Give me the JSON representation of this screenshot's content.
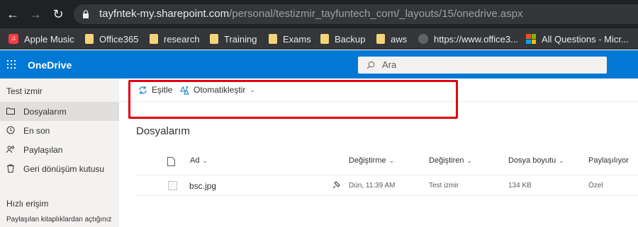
{
  "browser": {
    "url_host": "tayfntek-my.sharepoint.com",
    "url_path": "/personal/testizmir_tayfuntech_com/_layouts/15/onedrive.aspx",
    "bookmarks": [
      {
        "label": "Apple Music",
        "icon": "apple-music-icon"
      },
      {
        "label": "Office365",
        "icon": "folder-icon"
      },
      {
        "label": "research",
        "icon": "folder-icon"
      },
      {
        "label": "Training",
        "icon": "folder-icon"
      },
      {
        "label": "Exams",
        "icon": "folder-icon"
      },
      {
        "label": "Backup",
        "icon": "folder-icon"
      },
      {
        "label": "aws",
        "icon": "folder-icon"
      },
      {
        "label": "https://www.office3...",
        "icon": "globe-icon"
      },
      {
        "label": "All Questions - Micr...",
        "icon": "microsoft-icon"
      }
    ]
  },
  "header": {
    "app_title": "OneDrive",
    "search_placeholder": "Ara",
    "brand_color": "#0078d4"
  },
  "sidebar": {
    "user": "Test izmir",
    "items": [
      {
        "label": "Dosyalarım",
        "icon": "folder-outline-icon",
        "active": true
      },
      {
        "label": "En son",
        "icon": "recent-icon"
      },
      {
        "label": "Paylaşılan",
        "icon": "shared-icon"
      },
      {
        "label": "Geri dönüşüm kutusu",
        "icon": "recycle-bin-icon"
      }
    ],
    "quick_access_title": "Hızlı erişim",
    "quick_access_sub": "Paylaşılan kitaplıklardan açtığınız"
  },
  "commandbar": {
    "sync_label": "Eşitle",
    "automate_label": "Otomatikleştir"
  },
  "main": {
    "title": "Dosyalarım",
    "columns": [
      "Ad",
      "Değiştirme",
      "Değiştiren",
      "Dosya boyutu",
      "Paylaşılıyor"
    ],
    "rows": [
      {
        "name": "bsc.jpg",
        "modified": "Dün, 11:39 AM",
        "modified_by": "Test izmir",
        "size": "134 KB",
        "sharing": "Özel"
      }
    ]
  }
}
